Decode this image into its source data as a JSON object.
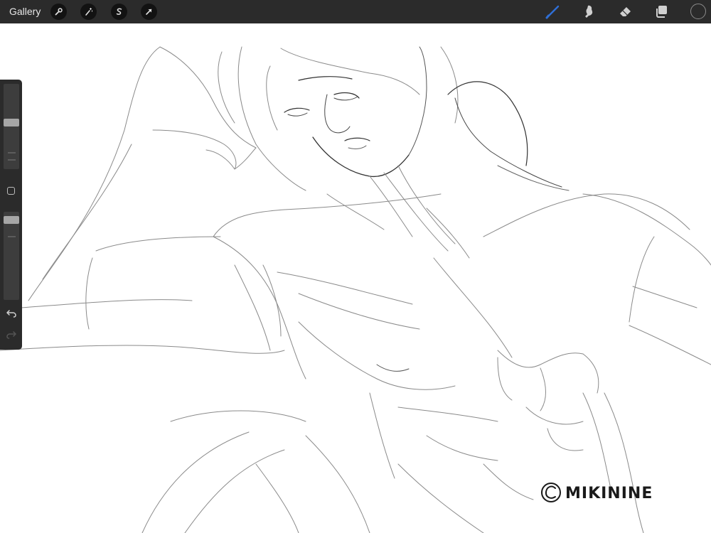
{
  "app": {
    "gallery_label": "Gallery"
  },
  "toolbar": {
    "left_tools": [
      "wrench-icon",
      "magic-wand-icon",
      "selection-icon",
      "transform-arrow-icon"
    ],
    "right_tools": [
      "brush-icon",
      "smudge-icon",
      "eraser-icon",
      "layers-icon"
    ],
    "active_tool": "brush",
    "active_color": "#2f6fd6",
    "current_color": "#2b2b2b"
  },
  "sidebar": {
    "brush_size_level": 0.55,
    "opacity_level": 0.95,
    "buttons": [
      "modify-square-icon",
      "undo-icon",
      "redo-icon"
    ]
  },
  "artwork": {
    "watermark_text": "©MIKININE"
  }
}
